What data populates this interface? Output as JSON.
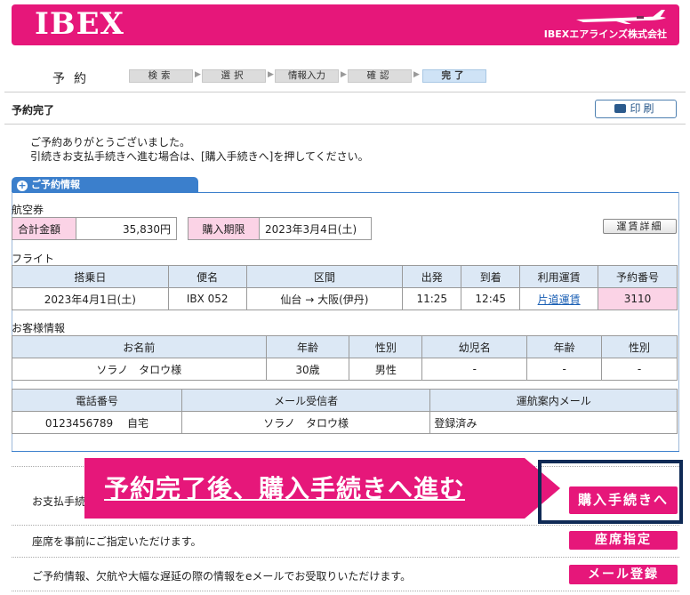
{
  "header": {
    "logo": "IBEX",
    "company": "IBEXエアラインズ株式会社"
  },
  "steps": {
    "title": "予約",
    "items": [
      "検索",
      "選択",
      "情報入力",
      "確認",
      "完了"
    ],
    "active_index": 4
  },
  "page": {
    "title": "予約完了",
    "print_label": "印刷"
  },
  "thanks": {
    "line1": "ご予約ありがとうございました。",
    "line2": "引続きお支払手続きへ進む場合は、[購入手続きへ]を押してください。"
  },
  "section": {
    "tab": "ご予約情報"
  },
  "ticket": {
    "label": "航空券",
    "total_label": "合計金額",
    "total_value": "35,830円",
    "deadline_label": "購入期限",
    "deadline_value": "2023年3月4日(土)",
    "fare_detail_button": "運賃詳細"
  },
  "flight": {
    "label": "フライト",
    "headers": [
      "搭乗日",
      "便名",
      "区間",
      "出発",
      "到着",
      "利用運賃",
      "予約番号"
    ],
    "row": {
      "date": "2023年4月1日(土)",
      "flight_no": "IBX 052",
      "route": "仙台 → 大阪(伊丹)",
      "depart": "11:25",
      "arrive": "12:45",
      "fare": "片道運賃",
      "reservation_no": "3110"
    }
  },
  "customer": {
    "label": "お客様情報",
    "headers": [
      "お名前",
      "年齢",
      "性別",
      "幼児名",
      "年齢",
      "性別"
    ],
    "row": {
      "name": "ソラノ　タロウ様",
      "age": "30歳",
      "gender": "男性",
      "infant_name": "-",
      "infant_age": "-",
      "infant_gender": "-"
    }
  },
  "contact": {
    "headers": [
      "電話番号",
      "メール受信者",
      "運航案内メール"
    ],
    "row": {
      "phone": "0123456789　 自宅",
      "recipient": "ソラノ　タロウ様",
      "notice": "登録済み"
    }
  },
  "actions": [
    {
      "text": "お支払手続",
      "button": "購入手続きへ"
    },
    {
      "text": "座席を事前にご指定いただけます。",
      "button": "座席指定"
    },
    {
      "text": "ご予約情報、欠航や大幅な遅延の際の情報をeメールでお受取りいただけます。",
      "button": "メール登録"
    }
  ],
  "annotation": {
    "text": "予約完了後、購入手続きへ進む"
  },
  "colors": {
    "brand_pink": "#e6177a",
    "section_blue": "#3b7fcc",
    "header_blue": "#dce8f5",
    "cell_pink": "#fbd3e6",
    "annotation_navy": "#0f2a55"
  }
}
